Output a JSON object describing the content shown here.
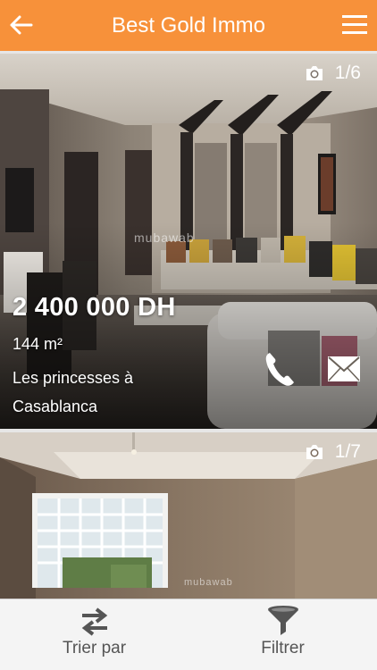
{
  "header": {
    "title": "Best Gold Immo",
    "back_icon": "arrow-left-icon",
    "menu_icon": "hamburger-menu-icon",
    "background": "#f7913a"
  },
  "listings": [
    {
      "photo_counter": "1/6",
      "price": "2 400 000 DH",
      "area": "144 m²",
      "location": "Les princesses à Casablanca",
      "watermark": "mubawab",
      "call_icon": "phone-icon",
      "email_icon": "envelope-icon"
    },
    {
      "photo_counter": "1/7",
      "watermark": "mubawab"
    }
  ],
  "bottom_bar": {
    "sort_label": "Trier par",
    "sort_icon": "swap-arrows-icon",
    "filter_label": "Filtrer",
    "filter_icon": "funnel-icon"
  }
}
